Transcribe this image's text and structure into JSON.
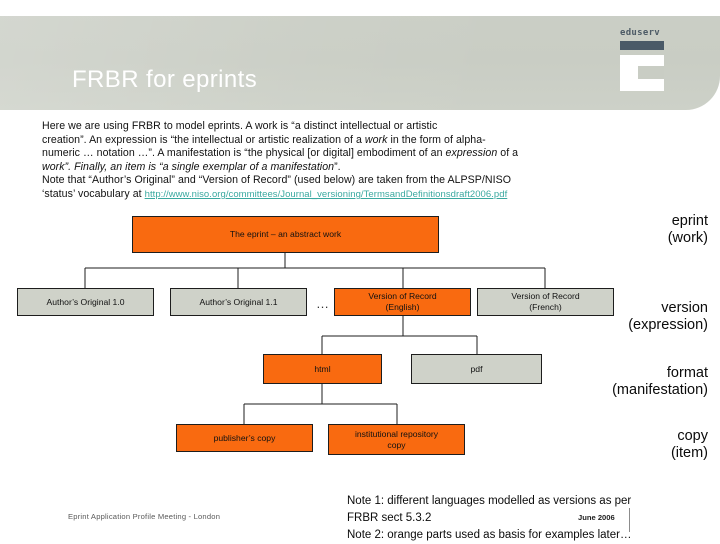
{
  "header": {
    "title": "FRBR for eprints",
    "logo_word": "eduserv",
    "logo_name": "eduserv-logo"
  },
  "intro": {
    "line1": "Here we are using FRBR to model eprints.  A work is “a distinct intellectual or artistic",
    "line2a": "creation”. An expression is “the intellectual or artistic realization of a ",
    "line2i": "work",
    "line2b": " in the form of alpha-",
    "line3a": "numeric … notation …”.  A manifestation is “the physical [or digital] embodiment of an ",
    "line3i": "expression",
    "line3b": " of a",
    "line4a": "work”.  Finally, an item is “a single exemplar of a ",
    "line4i": "manifestation",
    "line4b": "”.",
    "line5": "Note that “Author’s Original” and “Version of Record” (used below) are taken from the ALPSP/NISO",
    "line6_prefix": "‘status’ vocabulary at ",
    "link_text": "http://www.niso.org/committees/Journal_versioning/TermsandDefinitionsdraft2006.pdf"
  },
  "diagram": {
    "nodes": [
      {
        "id": "eprint",
        "label": "The eprint – an abstract work",
        "color": "orange"
      },
      {
        "id": "ao10",
        "label": "Author’s Original 1.0",
        "color": "grey"
      },
      {
        "id": "ao11",
        "label": "Author’s Original 1.1",
        "color": "grey"
      },
      {
        "id": "vor-en",
        "label": "Version of Record\n(English)",
        "color": "orange"
      },
      {
        "id": "vor-fr",
        "label": "Version of Record\n(French)",
        "color": "grey"
      },
      {
        "id": "html",
        "label": "html",
        "color": "orange"
      },
      {
        "id": "pdf",
        "label": "pdf",
        "color": "grey"
      },
      {
        "id": "publisher",
        "label": "publisher’s copy",
        "color": "orange"
      },
      {
        "id": "irc",
        "label": "institutional repository\ncopy",
        "color": "orange"
      }
    ],
    "ellipsis": "…",
    "colors": {
      "orange": "#f96a10",
      "grey": "#cfd2c9",
      "line": "#1d1d1d",
      "header_bg": "#c9cdc4",
      "link": "#3aa9a0"
    }
  },
  "legend": {
    "items": [
      {
        "top": "eprint",
        "bottom": "(work)"
      },
      {
        "top": "version",
        "bottom": "(expression)"
      },
      {
        "top": "format",
        "bottom": "(manifestation)"
      },
      {
        "top": "copy",
        "bottom": "(item)"
      }
    ]
  },
  "footer": {
    "meeting": "Eprint Application Profile Meeting - London",
    "date": "June 2006",
    "note1a": "Note 1: different languages modelled as versions as per",
    "note1b": "FRBR sect 5.3.2",
    "note2": "Note 2: orange parts used as basis for examples later…"
  }
}
